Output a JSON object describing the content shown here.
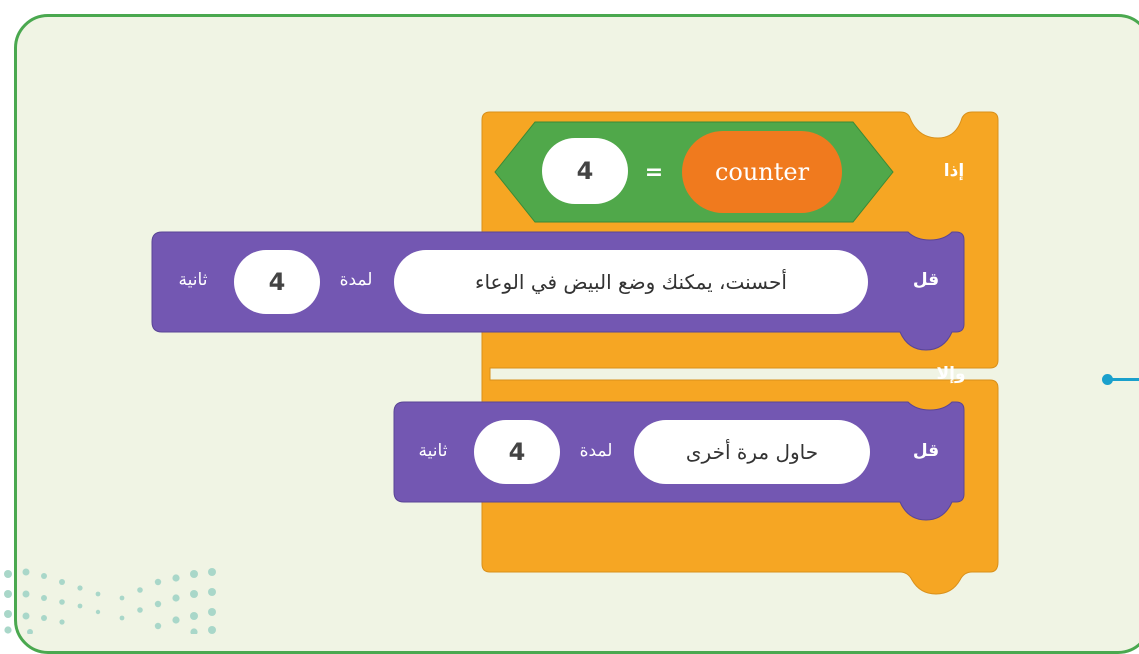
{
  "if_block": {
    "if_label": "إذا",
    "else_label": "وإلا"
  },
  "condition": {
    "left_value": "4",
    "operator": "=",
    "variable": "counter"
  },
  "say_then": {
    "say_label": "قل",
    "message": "أحسنت، يمكنك وضع البيض في الوعاء",
    "for_label": "لمدة",
    "seconds": "4",
    "unit_label": "ثانية"
  },
  "say_else": {
    "say_label": "قل",
    "message": "حاول مرة أخرى",
    "for_label": "لمدة",
    "seconds": "4",
    "unit_label": "ثانية"
  },
  "colors": {
    "control": "#f6a623",
    "looks": "#7357b2",
    "operator": "#50a84a",
    "variable": "#f07a1e",
    "panel_border": "#4aa84f",
    "panel_bg": "#f0f4e4"
  }
}
